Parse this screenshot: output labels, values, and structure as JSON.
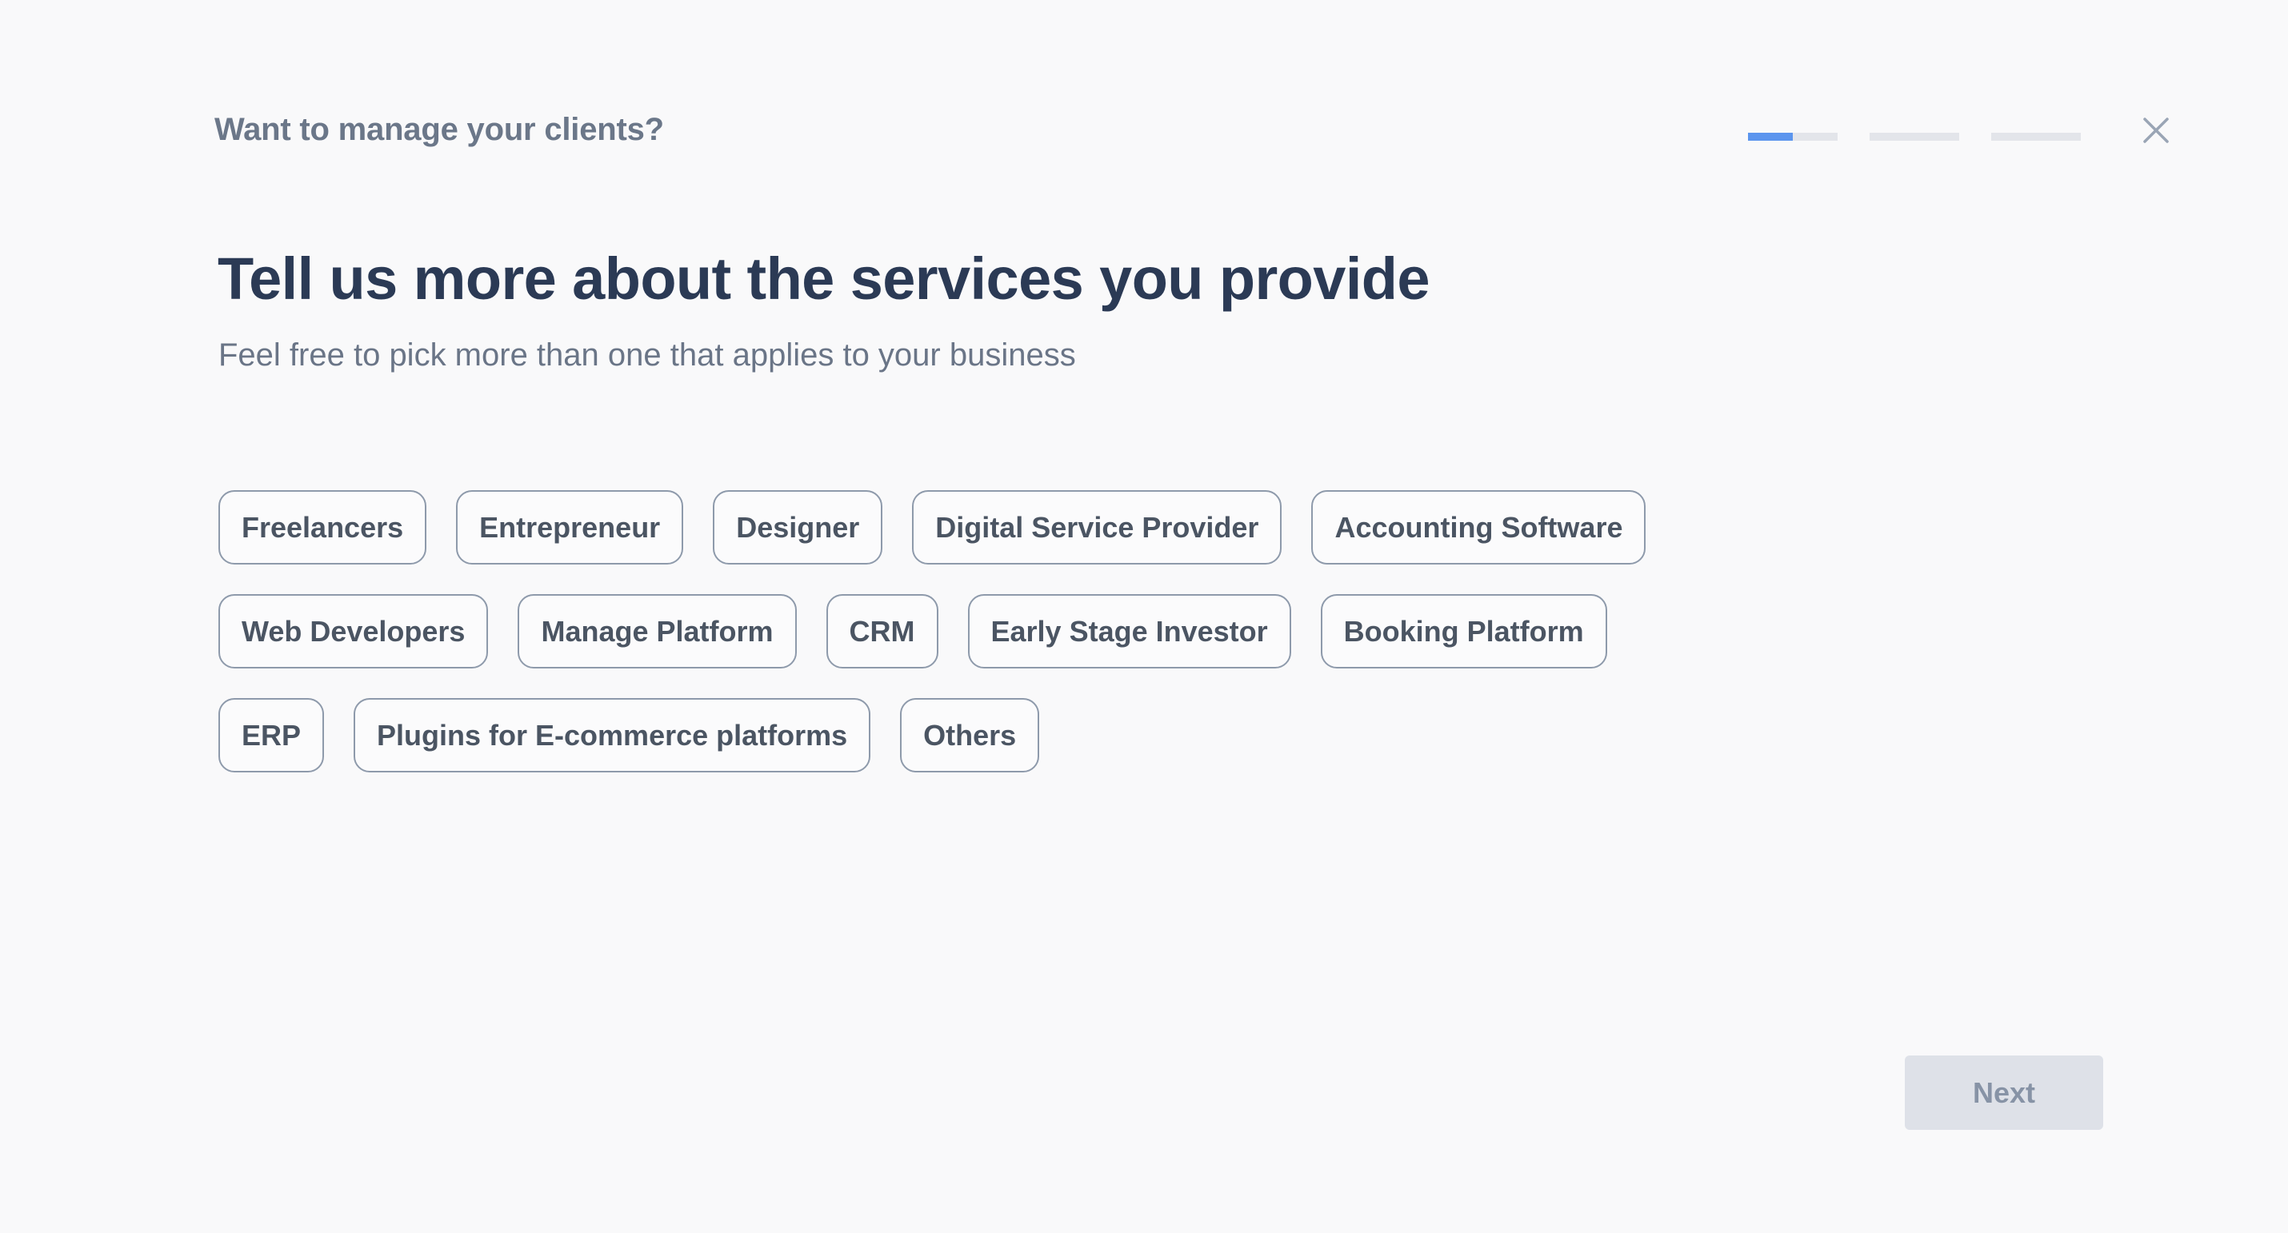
{
  "header": {
    "eyebrow": "Want to manage your clients?",
    "progress": {
      "total_steps": 3,
      "current_step": 1,
      "segments": [
        {
          "fill_fraction": 0.5
        },
        {
          "fill_fraction": 0
        },
        {
          "fill_fraction": 0
        }
      ],
      "accent_color": "#5b95ee",
      "track_color": "#e3e5ea"
    },
    "close_icon": "close-icon"
  },
  "main": {
    "title": "Tell us more about the services you provide",
    "subtitle": "Feel free to pick more than one that applies to your business",
    "chip_rows": [
      [
        {
          "label": "Freelancers",
          "selected": false
        },
        {
          "label": "Entrepreneur",
          "selected": false
        },
        {
          "label": "Designer",
          "selected": false
        },
        {
          "label": "Digital Service Provider",
          "selected": false
        },
        {
          "label": "Accounting Software",
          "selected": false
        }
      ],
      [
        {
          "label": "Web Developers",
          "selected": false
        },
        {
          "label": "Manage Platform",
          "selected": false
        },
        {
          "label": "CRM",
          "selected": false
        },
        {
          "label": "Early Stage Investor",
          "selected": false
        },
        {
          "label": "Booking Platform",
          "selected": false
        }
      ],
      [
        {
          "label": "ERP",
          "selected": false
        },
        {
          "label": "Plugins for E-commerce platforms",
          "selected": false
        },
        {
          "label": "Others",
          "selected": false
        }
      ]
    ]
  },
  "footer": {
    "next_label": "Next",
    "next_disabled": true
  }
}
